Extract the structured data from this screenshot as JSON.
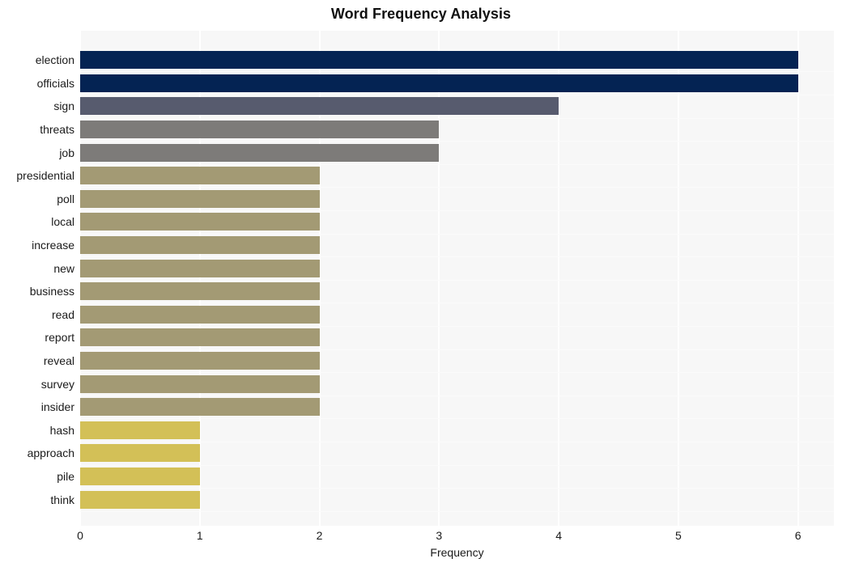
{
  "chart_data": {
    "type": "bar",
    "orientation": "horizontal",
    "title": "Word Frequency Analysis",
    "xlabel": "Frequency",
    "ylabel": "",
    "xlim": [
      0,
      6.3
    ],
    "xticks": [
      0,
      1,
      2,
      3,
      4,
      5,
      6
    ],
    "xtick_labels": [
      "0",
      "1",
      "2",
      "3",
      "4",
      "5",
      "6"
    ],
    "grid": true,
    "grid_axis": "x",
    "legend": "none",
    "categories": [
      "election",
      "officials",
      "sign",
      "threats",
      "job",
      "presidential",
      "poll",
      "local",
      "increase",
      "new",
      "business",
      "read",
      "report",
      "reveal",
      "survey",
      "insider",
      "hash",
      "approach",
      "pile",
      "think"
    ],
    "values": [
      6,
      6,
      4,
      3,
      3,
      2,
      2,
      2,
      2,
      2,
      2,
      2,
      2,
      2,
      2,
      2,
      1,
      1,
      1,
      1
    ],
    "bar_colors": [
      "#042353",
      "#042353",
      "#575b6e",
      "#7d7b79",
      "#7d7b79",
      "#a39a74",
      "#a39a74",
      "#a39a74",
      "#a39a74",
      "#a39a74",
      "#a39a74",
      "#a39a74",
      "#a39a74",
      "#a39a74",
      "#a39a74",
      "#a39a74",
      "#d3c057",
      "#d3c057",
      "#d3c057",
      "#d3c057"
    ],
    "plot_background": "#f7f7f7",
    "gridline_color": "#ffffff",
    "figure_background": "#ffffff"
  }
}
